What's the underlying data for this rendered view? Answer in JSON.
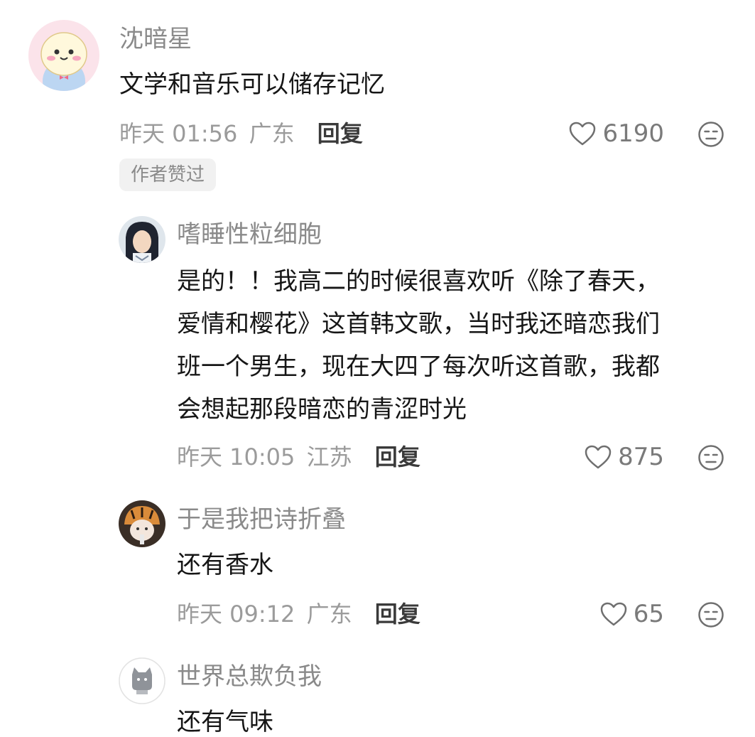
{
  "comments": [
    {
      "username": "沈暗星",
      "text": "文学和音乐可以储存记忆",
      "time": "昨天 01:56",
      "location": "广东",
      "reply_label": "回复",
      "likes": "6190",
      "badge": "作者赞过",
      "avatar_icon": "cartoon-chick-avatar"
    },
    {
      "username": "嗜睡性粒细胞",
      "text_lines": [
        "是的！！我高二的时候很喜欢听《除了春天，",
        "爱情和樱花》这首韩文歌，当时我还暗恋我们",
        "班一个男生，现在大四了每次听这首歌，我都",
        "会想起那段暗恋的青涩时光"
      ],
      "time": "昨天 10:05",
      "location": "江苏",
      "reply_label": "回复",
      "likes": "875",
      "avatar_icon": "anime-character-avatar"
    },
    {
      "username": "于是我把诗折叠",
      "text": "还有香水",
      "time": "昨天 09:12",
      "location": "广东",
      "reply_label": "回复",
      "likes": "65",
      "avatar_icon": "tiger-hat-avatar"
    },
    {
      "username": "世界总欺负我",
      "text": "还有气味",
      "avatar_icon": "gray-cat-avatar"
    }
  ],
  "colors": {
    "username": "#8a8a8a",
    "text": "#161616",
    "meta": "#9b9b9b",
    "reply": "#3a3a3a",
    "badge_bg": "#f1f1f1"
  }
}
